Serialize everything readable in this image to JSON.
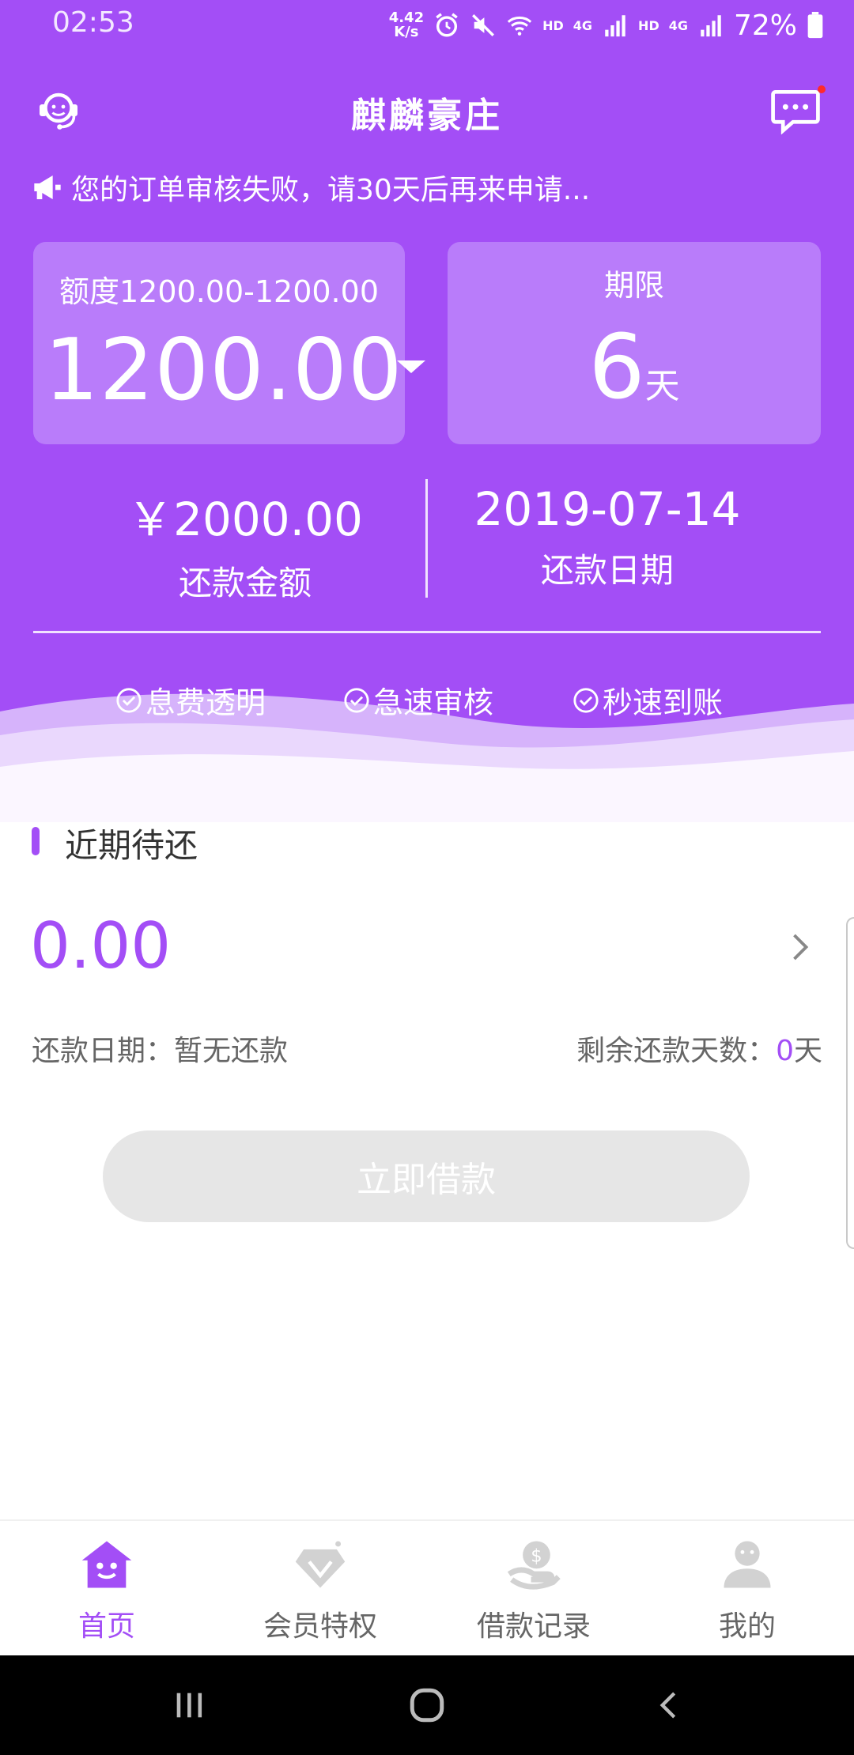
{
  "status": {
    "time": "02:53",
    "speed_value": "4.42",
    "speed_unit": "K/s",
    "hd1": "HD",
    "net1": "4G",
    "hd2": "HD",
    "net2": "4G",
    "battery": "72%"
  },
  "header": {
    "title": "麒麟豪庄"
  },
  "notice": {
    "text": "您的订单审核失败，请30天后再来申请..."
  },
  "quota_card": {
    "label": "额度1200.00-1200.00",
    "amount": "1200.00"
  },
  "term_card": {
    "label": "期限",
    "value": "6",
    "unit": "天"
  },
  "repay": {
    "amount": "￥2000.00",
    "amount_label": "还款金额",
    "date": "2019-07-14",
    "date_label": "还款日期"
  },
  "features": [
    "息费透明",
    "急速审核",
    "秒速到账"
  ],
  "pending": {
    "title": "近期待还",
    "amount": "0.00",
    "date_label": "还款日期：暂无还款",
    "days_prefix": "剩余还款天数：",
    "days_value": "0",
    "days_unit": "天"
  },
  "borrow_button": "立即借款",
  "tabs": [
    {
      "label": "首页",
      "icon": "home-icon"
    },
    {
      "label": "会员特权",
      "icon": "diamond-icon"
    },
    {
      "label": "借款记录",
      "icon": "loan-record-icon"
    },
    {
      "label": "我的",
      "icon": "profile-icon"
    }
  ],
  "colors": {
    "accent": "#a34ef6",
    "card": "#b97cfa",
    "disabled_button": "#e6e6e6"
  }
}
